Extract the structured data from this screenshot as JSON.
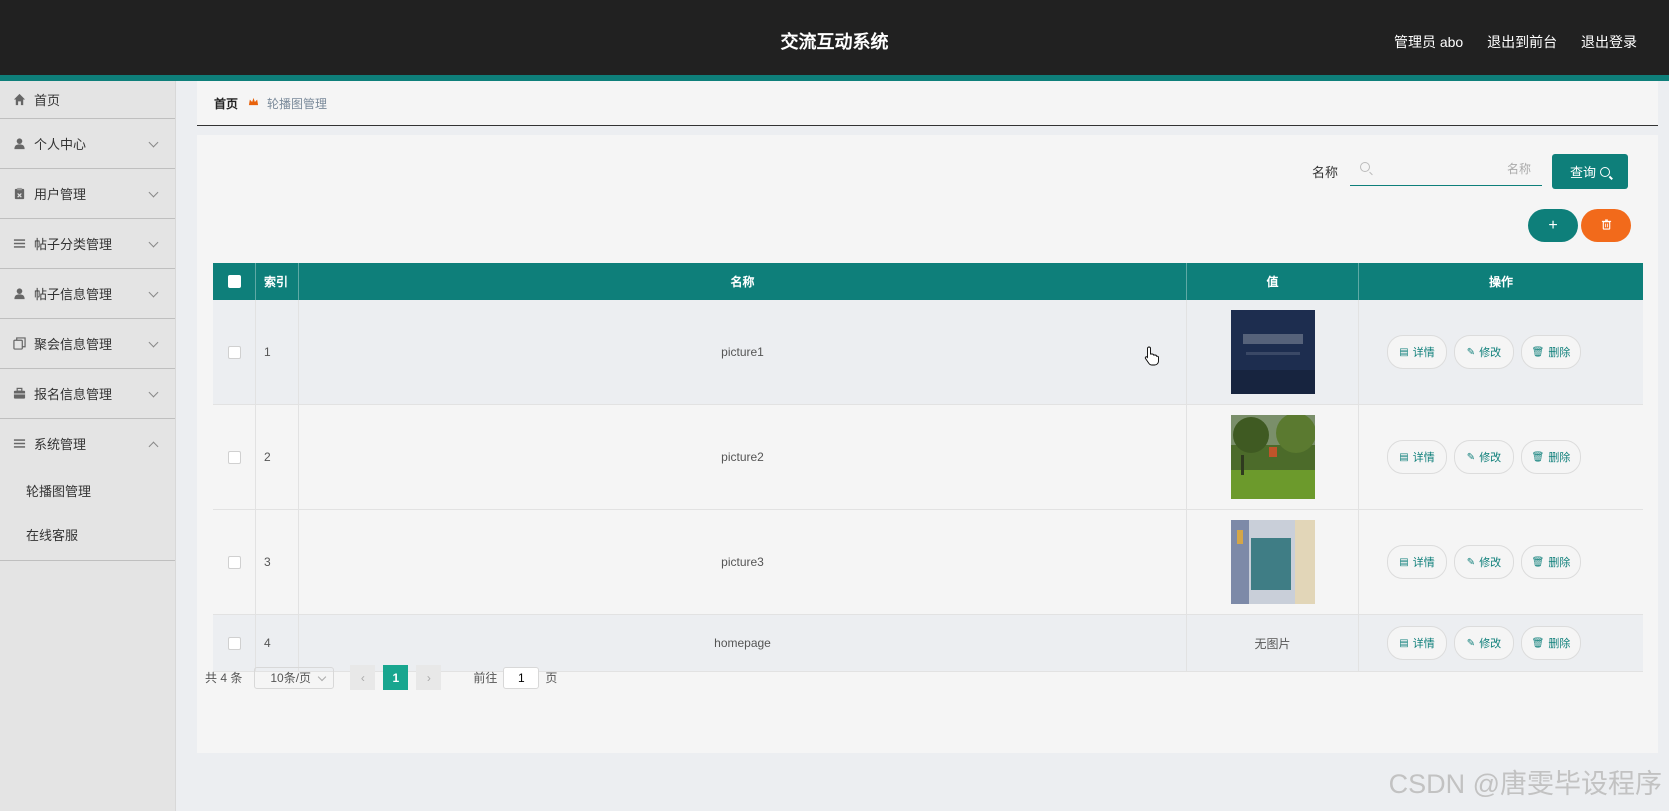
{
  "header": {
    "title": "交流互动系统",
    "admin_label": "管理员 abo",
    "front_label": "退出到前台",
    "logout_label": "退出登录"
  },
  "sidebar": {
    "items": [
      {
        "label": "首页",
        "icon": "home-icon"
      },
      {
        "label": "个人中心",
        "icon": "user-icon"
      },
      {
        "label": "用户管理",
        "icon": "clipboard-icon"
      },
      {
        "label": "帖子分类管理",
        "icon": "list-icon"
      },
      {
        "label": "帖子信息管理",
        "icon": "user-icon"
      },
      {
        "label": "聚会信息管理",
        "icon": "copy-icon"
      },
      {
        "label": "报名信息管理",
        "icon": "briefcase-icon"
      },
      {
        "label": "系统管理",
        "icon": "menu-icon"
      }
    ],
    "sub_items": [
      {
        "label": "轮播图管理"
      },
      {
        "label": "在线客服"
      }
    ]
  },
  "breadcrumb": {
    "home": "首页",
    "current": "轮播图管理"
  },
  "search": {
    "label": "名称",
    "placeholder": "名称",
    "button": "查询"
  },
  "actions": {
    "add": "+"
  },
  "table": {
    "headers": {
      "index": "索引",
      "name": "名称",
      "value": "值",
      "ops": "操作"
    },
    "rows": [
      {
        "index": "1",
        "name": "picture1",
        "value": "",
        "thumb": "thumb-dark"
      },
      {
        "index": "2",
        "name": "picture2",
        "value": "",
        "thumb": "thumb-park"
      },
      {
        "index": "3",
        "name": "picture3",
        "value": "",
        "thumb": "thumb-room"
      },
      {
        "index": "4",
        "name": "homepage",
        "value": "无图片",
        "thumb": ""
      }
    ],
    "op_labels": {
      "detail": "详情",
      "edit": "修改",
      "delete": "删除"
    }
  },
  "pager": {
    "total": "共 4 条",
    "page_size": "10条/页",
    "current_page": "1",
    "goto_prefix": "前往",
    "goto_value": "1",
    "goto_suffix": "页"
  },
  "watermark": "CSDN @唐雯毕设程序",
  "colors": {
    "accent": "#0e7f7a",
    "danger": "#f26a1b",
    "topbar": "#212121"
  }
}
